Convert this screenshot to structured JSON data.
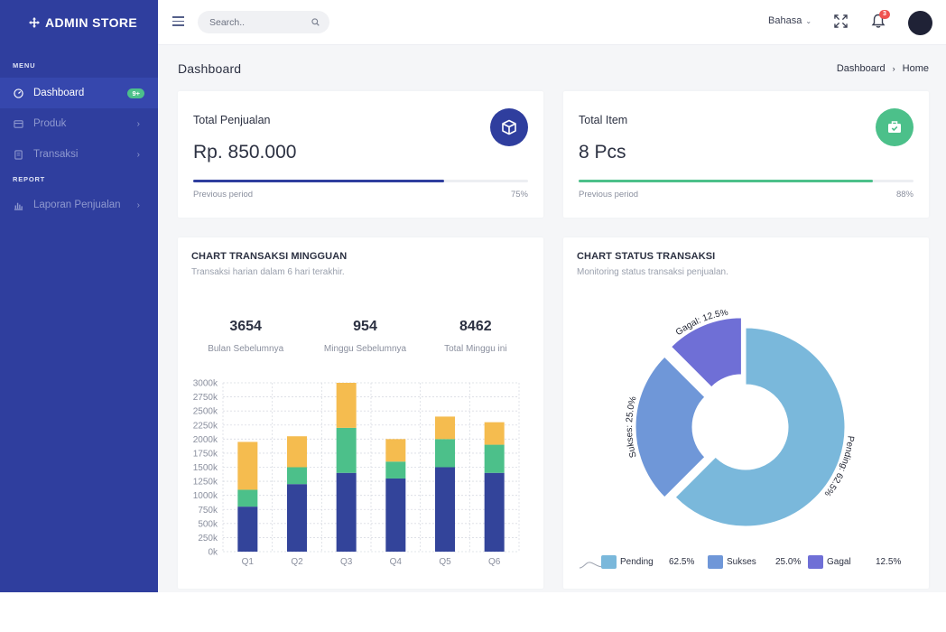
{
  "app": {
    "brand": "ADMIN STORE",
    "menu_section": "MENU",
    "report_section": "REPORT"
  },
  "sidebar": {
    "items": [
      {
        "label": "Dashboard",
        "icon": "gauge-icon",
        "badge": "9+"
      },
      {
        "label": "Produk",
        "icon": "box-icon"
      },
      {
        "label": "Transaksi",
        "icon": "clipboard-icon"
      },
      {
        "label": "Laporan Penjualan",
        "icon": "chart-icon"
      }
    ]
  },
  "header": {
    "search_placeholder": "Search..",
    "language": "Bahasa",
    "notification_count": "3"
  },
  "page": {
    "title": "Dashboard",
    "breadcrumb": [
      "Dashboard",
      "Home"
    ]
  },
  "stats": [
    {
      "title": "Total Penjualan",
      "value": "Rp. 850.000",
      "period_label": "Previous period",
      "percent_label": "75%",
      "progress": 0.75,
      "color": "#2f3e9e",
      "icon": "cube-icon"
    },
    {
      "title": "Total Item",
      "value": "8 Pcs",
      "period_label": "Previous period",
      "percent_label": "88%",
      "progress": 0.88,
      "color": "#4cc08a",
      "icon": "briefcase-icon"
    }
  ],
  "weekly_chart": {
    "title": "CHART TRANSAKSI MINGGUAN",
    "subtitle": "Transaksi harian dalam 6 hari terakhir.",
    "kpis": [
      {
        "value": "3654",
        "label": "Bulan Sebelumnya"
      },
      {
        "value": "954",
        "label": "Minggu Sebelumnya"
      },
      {
        "value": "8462",
        "label": "Total Minggu ini"
      }
    ]
  },
  "status_chart": {
    "title": "CHART STATUS TRANSAKSI",
    "subtitle": "Monitoring status transaksi penjualan."
  },
  "colors": {
    "primary": "#2f3e9e",
    "green": "#4cc08a",
    "yellow": "#f5bc4f",
    "bar_dark": "#33449a",
    "pie_pending": "#7ab8db",
    "pie_sukses": "#6f97d8",
    "pie_gagal": "#6f6fd6"
  },
  "chart_data": [
    {
      "type": "bar",
      "stacked": true,
      "categories": [
        "Q1",
        "Q2",
        "Q3",
        "Q4",
        "Q5",
        "Q6"
      ],
      "ylim": [
        0,
        3000
      ],
      "yticks": [
        "0k",
        "250k",
        "500k",
        "750k",
        "1000k",
        "1250k",
        "1500k",
        "1750k",
        "2000k",
        "2250k",
        "2500k",
        "2750k",
        "3000k"
      ],
      "grid": true,
      "series": [
        {
          "values": [
            800,
            1200,
            1400,
            1300,
            1500,
            1400
          ],
          "color": "#33449a"
        },
        {
          "values": [
            300,
            300,
            800,
            300,
            500,
            500
          ],
          "color": "#4cc08a"
        },
        {
          "values": [
            850,
            550,
            800,
            400,
            400,
            400
          ],
          "color": "#f5bc4f"
        }
      ]
    },
    {
      "type": "pie",
      "donut": true,
      "labels": [
        "Pending",
        "Sukses",
        "Gagal"
      ],
      "values": [
        62.5,
        25.0,
        12.5
      ],
      "value_labels": [
        "62.5%",
        "25.0%",
        "12.5%"
      ],
      "slice_labels": [
        "Pending: 62.5%",
        "Sukses: 25.0%",
        "Gagal: 12.5%"
      ],
      "colors": [
        "#7ab8db",
        "#6f97d8",
        "#6f6fd6"
      ],
      "legend": "bottom"
    }
  ]
}
